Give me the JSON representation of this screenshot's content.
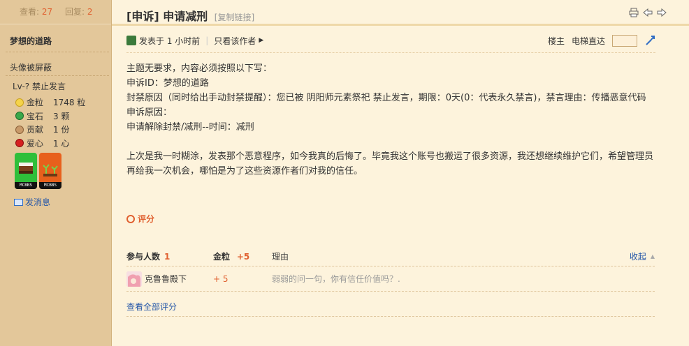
{
  "stats": {
    "views_label": "查看:",
    "views": "27",
    "replies_label": "回复:",
    "replies": "2"
  },
  "author": {
    "name": "梦想的道路",
    "avatar_text": "头像被屏蔽",
    "level": "Lv-? 禁止发言",
    "credits": [
      {
        "label": "金粒",
        "value": "1748 粒",
        "icon": "gold-nugget-icon",
        "color": "#f5d34a"
      },
      {
        "label": "宝石",
        "value": "3 颗",
        "icon": "emerald-icon",
        "color": "#3aa84a"
      },
      {
        "label": "贡献",
        "value": "1 份",
        "icon": "contribution-icon",
        "color": "#c89a6a"
      },
      {
        "label": "爱心",
        "value": "1 心",
        "icon": "apple-icon",
        "color": "#d62020"
      }
    ],
    "medals": [
      {
        "caption": "MCBBS",
        "icon": "cake-medal-icon",
        "color": "#2fbf3a"
      },
      {
        "caption": "MCBBS",
        "icon": "plant-medal-icon",
        "color": "#e8601c"
      }
    ],
    "pm_label": "发消息"
  },
  "post": {
    "title": "[申诉] 申请减刑",
    "copy_link": "[复制链接]",
    "posted": "发表于 1 小时前",
    "only_author": "只看该作者",
    "floor": "楼主",
    "jump": "电梯直达",
    "lines": [
      "主题无要求，内容必须按照以下写：",
      "申诉ID：梦想的道路",
      "封禁原因（同时给出手动封禁提醒）：您已被 阴阳师元素祭祀 禁止发言，期限：0天(0：代表永久禁言)，禁言理由：传播恶意代码",
      "申诉原因：",
      "申请解除封禁/减刑--时间：减刑"
    ],
    "paragraph": "上次是我一时糊涂，发表那个恶意程序，如今我真的后悔了。毕竟我这个账号也搬运了很多资源，我还想继续维护它们，希望管理员再给我一次机会，哪怕是为了这些资源作者们对我的信任。"
  },
  "rating": {
    "title": "评分",
    "head_participants": "参与人数",
    "participants": "1",
    "head_gold": "金粒",
    "gold_total": "+5",
    "head_reason": "理由",
    "collapse": "收起",
    "rows": [
      {
        "user": "克鲁鲁殿下",
        "gold": "+ 5",
        "reason": "弱弱的问一句，你有信任价值吗？."
      }
    ],
    "view_all": "查看全部评分"
  }
}
